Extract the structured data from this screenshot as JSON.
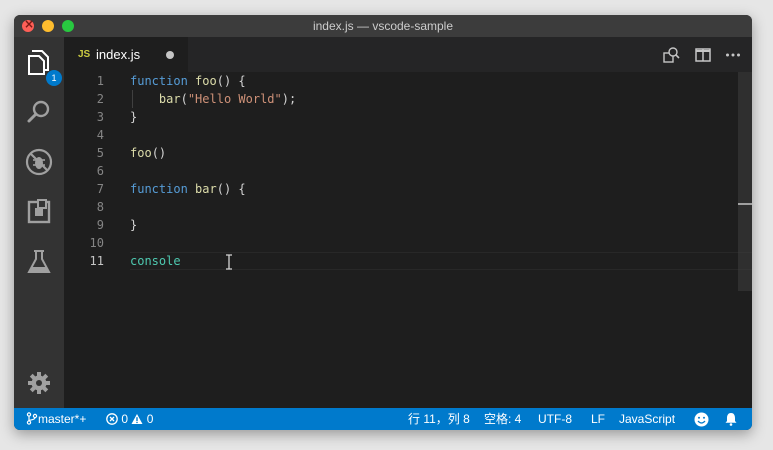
{
  "window": {
    "title": "index.js — vscode-sample"
  },
  "activity_bar": {
    "items": [
      {
        "name": "explorer",
        "icon": "files-icon",
        "badge": "1"
      },
      {
        "name": "search",
        "icon": "search-icon"
      },
      {
        "name": "debug",
        "icon": "no-bug-icon"
      },
      {
        "name": "extensions",
        "icon": "extensions-icon"
      },
      {
        "name": "test",
        "icon": "flask-icon"
      }
    ],
    "bottom": {
      "name": "settings",
      "icon": "gear-icon"
    }
  },
  "tabs": [
    {
      "icon_text": "JS",
      "label": "index.js",
      "dirty": true
    }
  ],
  "editor": {
    "lines": [
      "1",
      "2",
      "3",
      "4",
      "5",
      "6",
      "7",
      "8",
      "9",
      "10",
      "11"
    ],
    "active_line": "11",
    "code": {
      "l1": {
        "kw": "function",
        "name": "foo",
        "rest": "() {"
      },
      "l2": {
        "name": "bar",
        "open": "(",
        "str": "\"Hello World\"",
        "close": ");"
      },
      "l3": "}",
      "l5": {
        "name": "foo",
        "rest": "()"
      },
      "l7": {
        "kw": "function",
        "name": "bar",
        "rest": "() {"
      },
      "l9": "}",
      "l11": "console"
    }
  },
  "status_bar": {
    "branch": "master*+",
    "errors": "0",
    "warnings": "0",
    "position": "行 11，列 8",
    "indent": "空格: 4",
    "encoding": "UTF-8",
    "eol": "LF",
    "language": "JavaScript"
  },
  "colors": {
    "status_bar": "#007acc",
    "editor_bg": "#1e1e1e",
    "activity_bar": "#333333",
    "keyword": "#569cd6",
    "function": "#dcdcaa",
    "string": "#ce9178",
    "identifier": "#4ec9b0"
  }
}
